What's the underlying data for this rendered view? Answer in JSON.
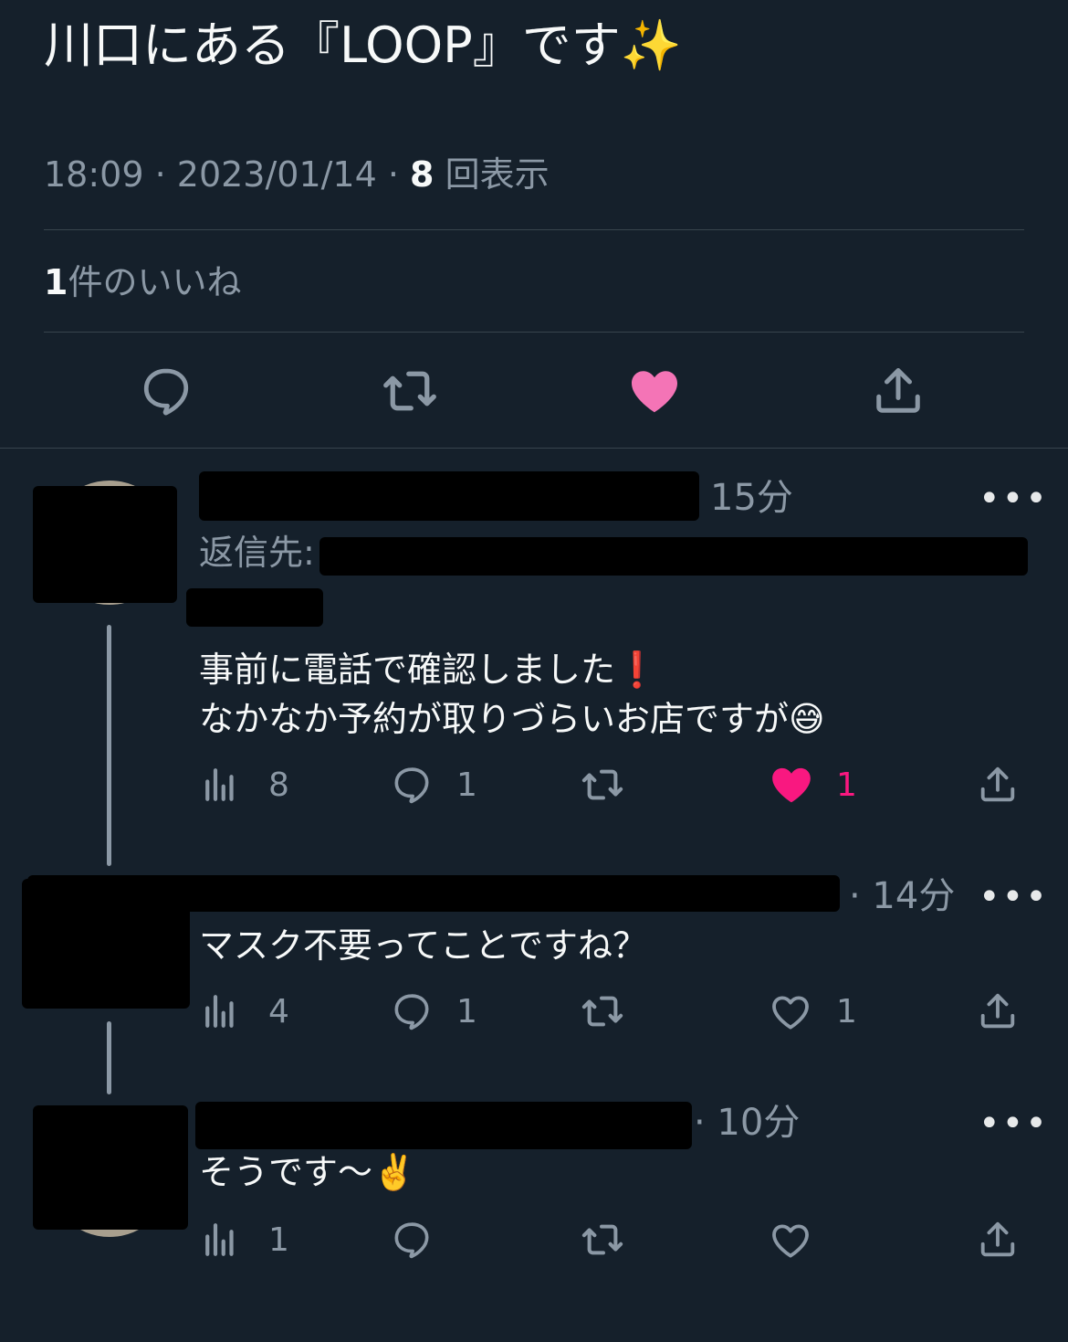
{
  "tweet": {
    "text": "川口にある『LOOP』です",
    "text_emoji": "✨",
    "time": "18:09",
    "date": "2023/01/14",
    "sep": " · ",
    "views_count": "8",
    "views_label": "回表示",
    "likes_count": "1",
    "likes_label": "件のいいね",
    "liked": true
  },
  "colors": {
    "background": "#15202b",
    "text_primary": "#f7f9f9",
    "text_secondary": "#8b98a5",
    "like_pink": "#f91880",
    "like_main_pink": "#f474b6",
    "divider": "#38444d"
  },
  "actions": [
    {
      "name": "reply",
      "icon": "reply-icon"
    },
    {
      "name": "retweet",
      "icon": "retweet-icon"
    },
    {
      "name": "like",
      "icon": "heart-filled-icon"
    },
    {
      "name": "share",
      "icon": "share-icon"
    }
  ],
  "replies": [
    {
      "time": "15分",
      "reply_to_label": "返信先:",
      "text_line1": "事前に電話で確認しました",
      "text_line1_emoji": "❗",
      "text_line2": "なかなか予約が取りづらいお店ですが",
      "text_line2_emoji": "😅",
      "views": "8",
      "replies": "1",
      "retweets": "",
      "likes": "1",
      "liked": true
    },
    {
      "time": "· 14分",
      "text_line1": "マスク不要ってことですね？",
      "views": "4",
      "replies": "1",
      "retweets": "",
      "likes": "1",
      "liked": false
    },
    {
      "time": "· 10分",
      "text_line1": "そうです〜",
      "text_line1_emoji": "✌️",
      "views": "1",
      "replies": "",
      "retweets": "",
      "likes": "",
      "liked": false
    }
  ],
  "more_label": "•••"
}
